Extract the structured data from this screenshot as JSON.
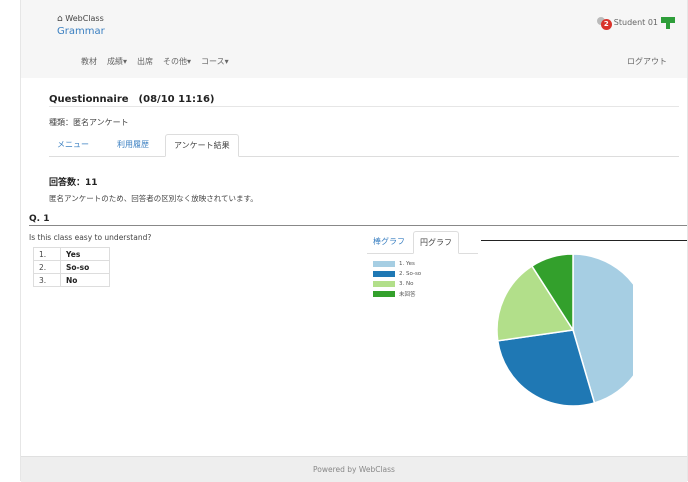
{
  "header": {
    "home_label": "WebClass",
    "course_title": "Grammar",
    "notification_count": "2",
    "user_name": "Student 01"
  },
  "nav": {
    "items": [
      {
        "label": "教材"
      },
      {
        "label": "成績▾"
      },
      {
        "label": "出席"
      },
      {
        "label": "その他▾"
      },
      {
        "label": "コース▾"
      }
    ],
    "logout_label": "ログアウト"
  },
  "page": {
    "title": "Questionnaire　(08/10 11:16)",
    "type_line": "種類：匿名アンケート",
    "tabs": [
      {
        "label": "メニュー"
      },
      {
        "label": "利用履歴"
      },
      {
        "label": "アンケート結果"
      }
    ],
    "active_tab": 2,
    "response_count": "回答数：11",
    "anon_note": "匿名アンケートのため、回答者の区別なく放映されています。"
  },
  "question": {
    "label": "Q. 1",
    "text": "Is this class easy to understand?",
    "options": [
      {
        "num": "1.",
        "label": "Yes"
      },
      {
        "num": "2.",
        "label": "So-so"
      },
      {
        "num": "3.",
        "label": "No"
      }
    ]
  },
  "chart_tabs": [
    {
      "label": "棒グラフ"
    },
    {
      "label": "円グラフ"
    }
  ],
  "chart_data": {
    "type": "pie",
    "title": "",
    "categories": [
      "1. Yes",
      "2. So-so",
      "3. No",
      "未回答"
    ],
    "values": [
      5,
      3,
      2,
      1
    ],
    "colors": [
      "#a6cee3",
      "#1f78b4",
      "#b2df8a",
      "#33a02c"
    ],
    "legend_position": "top-left"
  },
  "footer": {
    "text": "Powered by WebClass"
  },
  "colors": {
    "link": "#3a7fc1",
    "badge": "#d9332b",
    "avatar": "#2e9e3a"
  }
}
